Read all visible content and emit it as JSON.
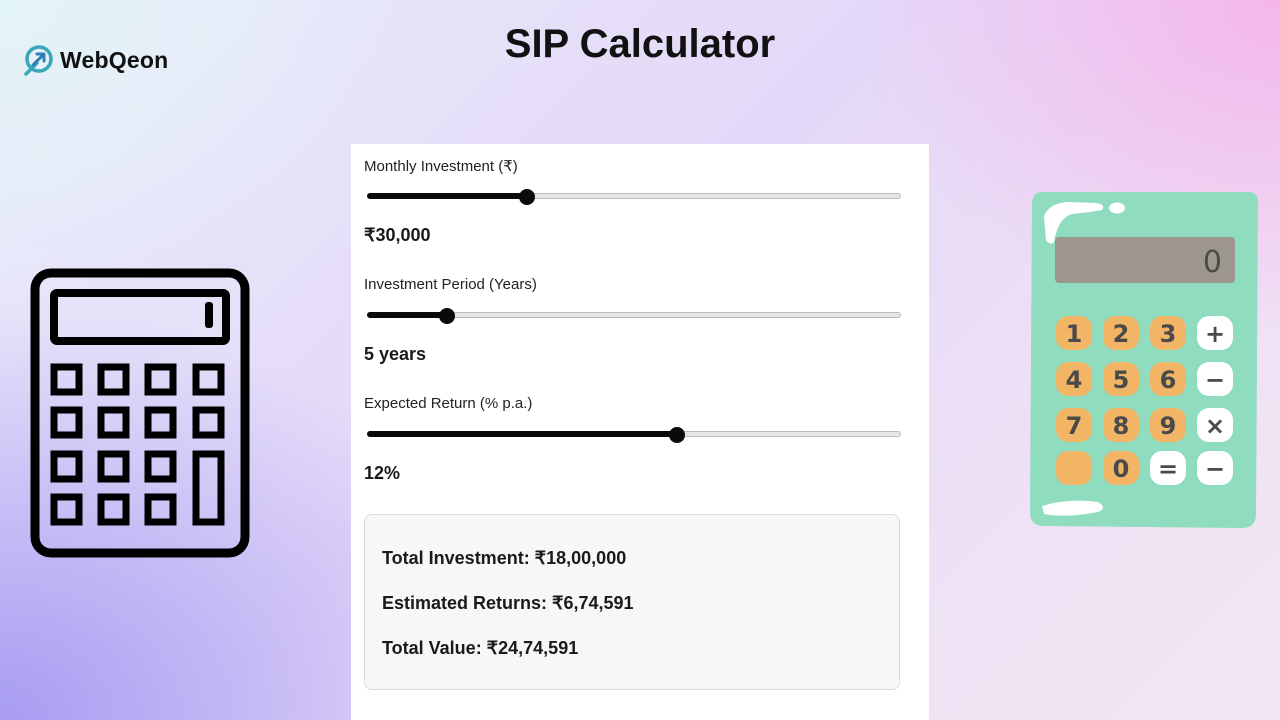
{
  "brand": {
    "name": "WebQeon",
    "icon": "webqeon-logo-icon"
  },
  "title": "SIP Calculator",
  "calculator": {
    "monthly": {
      "label": "Monthly Investment (₹)",
      "value": "₹30,000",
      "slider_fraction": 0.3
    },
    "period": {
      "label": "Investment Period (Years)",
      "value": "5 years",
      "slider_fraction": 0.15
    },
    "return": {
      "label": "Expected Return (% p.a.)",
      "value": "12%",
      "slider_fraction": 0.58
    }
  },
  "results": {
    "total_investment": "Total Investment: ₹18,00,000",
    "estimated_returns": "Estimated Returns: ₹6,74,591",
    "total_value": "Total Value: ₹24,74,591"
  },
  "illustrations": {
    "left_icon": "calculator-outline-icon",
    "right_icon": "calculator-cartoon-icon",
    "right_display": "0",
    "right_keys": [
      "1",
      "2",
      "3",
      "+",
      "4",
      "5",
      "6",
      "−",
      "7",
      "8",
      "9",
      "×",
      "",
      "0",
      "=",
      "−"
    ]
  },
  "colors": {
    "slider_fill": "#0a0a0a",
    "cartoon_body": "#8fdcbf",
    "cartoon_screen": "#9c968c",
    "cartoon_key": "#f2b566"
  }
}
